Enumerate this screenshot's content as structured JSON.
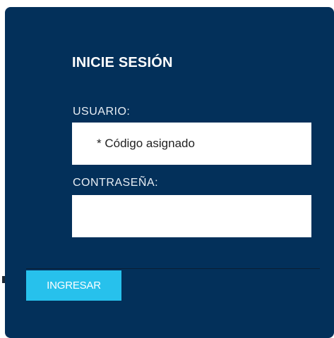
{
  "login": {
    "title": "INICIE SESIÓN",
    "username_label": "USUARIO:",
    "username_placeholder": "* Código asignado",
    "password_label": "CONTRASEÑA:",
    "password_value": "",
    "submit_label": "INGRESAR"
  },
  "colors": {
    "panel_background": "#03305a",
    "button_background": "#27c1ec",
    "input_background": "#ffffff"
  }
}
